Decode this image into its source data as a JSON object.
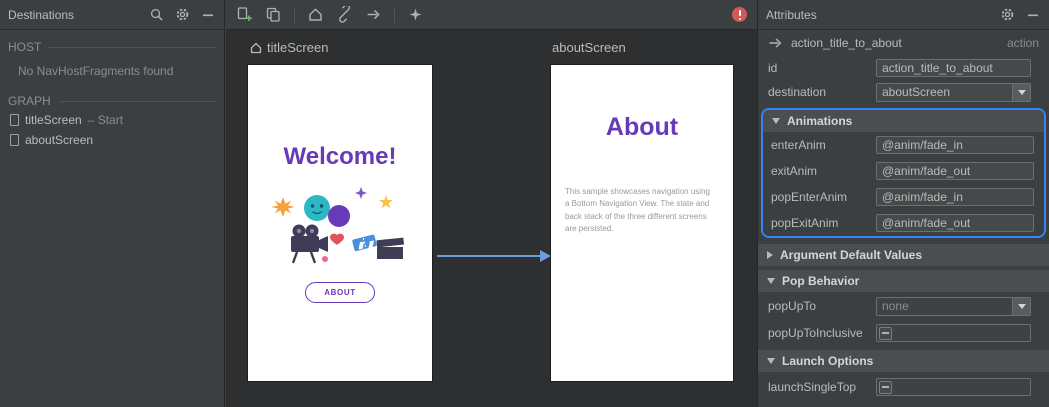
{
  "colors": {
    "accent_blue": "#3385f2",
    "brand_purple": "#673ab7",
    "arrow_blue": "#6e9ed6",
    "error_red": "#cf5b56",
    "panel_bg": "#3c3f41",
    "canvas_bg": "#2d2f31"
  },
  "destinations_panel": {
    "title": "Destinations",
    "header_icons": [
      "search-icon",
      "gear-icon",
      "minimize-icon"
    ],
    "host_header": "HOST",
    "host_empty_message": "No NavHostFragments found",
    "graph_header": "GRAPH",
    "graph_items": [
      {
        "label": "titleScreen",
        "suffix": "– Start"
      },
      {
        "label": "aboutScreen",
        "suffix": ""
      }
    ]
  },
  "canvas": {
    "toolbar_icons": [
      "add-destination-icon",
      "duplicate-icon",
      "home-icon",
      "deep-link-icon",
      "action-arrow-icon",
      "auto-arrange-icon",
      "error-icon"
    ],
    "title_screen": {
      "label": "titleScreen",
      "heading": "Welcome!",
      "button_label": "ABOUT"
    },
    "about_screen": {
      "label": "aboutScreen",
      "heading": "About",
      "body": "This sample showcases navigation using a Bottom Navigation View. The state and back stack of the three different screens are persisted."
    }
  },
  "attributes_panel": {
    "title": "Attributes",
    "header_icons": [
      "gear-icon",
      "minimize-icon"
    ],
    "action": {
      "name": "action_title_to_about",
      "type": "action"
    },
    "id_label": "id",
    "id_value": "action_title_to_about",
    "destination_label": "destination",
    "destination_value": "aboutScreen",
    "animations": {
      "header": "Animations",
      "expanded": true,
      "highlighted": true,
      "rows": [
        {
          "label": "enterAnim",
          "value": "@anim/fade_in"
        },
        {
          "label": "exitAnim",
          "value": "@anim/fade_out"
        },
        {
          "label": "popEnterAnim",
          "value": "@anim/fade_in"
        },
        {
          "label": "popExitAnim",
          "value": "@anim/fade_out"
        }
      ]
    },
    "argument_defaults": {
      "header": "Argument Default Values",
      "expanded": false
    },
    "pop_behavior": {
      "header": "Pop Behavior",
      "expanded": true,
      "popupto_label": "popUpTo",
      "popupto_value": "none",
      "popuptoinclusive_label": "popUpToInclusive",
      "popuptoinclusive_state": "indeterminate"
    },
    "launch_options": {
      "header": "Launch Options",
      "expanded": true,
      "launchsingletop_label": "launchSingleTop",
      "launchsingletop_state": "indeterminate"
    }
  }
}
